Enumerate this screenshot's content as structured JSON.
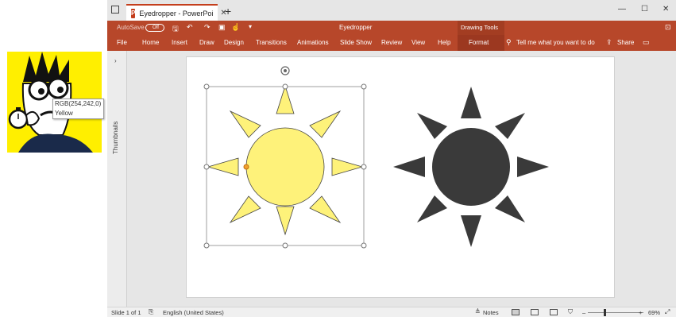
{
  "tooltip": {
    "rgb": "RGB(254,242,0)",
    "name": "Yellow"
  },
  "window": {
    "tab_title": "Eyedropper - PowerPoi",
    "doc_title": "Eyedropper",
    "autosave_label": "AutoSave",
    "autosave_state": "Off",
    "context_group": "Drawing Tools"
  },
  "ribbon": {
    "tabs": [
      "File",
      "Home",
      "Insert",
      "Draw",
      "Design",
      "Transitions",
      "Animations",
      "Slide Show",
      "Review",
      "View",
      "Help",
      "Format"
    ],
    "tell_me": "Tell me what you want to do",
    "share": "Share"
  },
  "panes": {
    "thumbnails": "Thumbnails"
  },
  "status": {
    "slide": "Slide 1 of 1",
    "language": "English (United States)",
    "notes": "Notes",
    "zoom": "69%"
  },
  "colors": {
    "accent": "#b7472a",
    "sun_yellow": "#fef27a",
    "sun_dark": "#3a3a3a",
    "cartoon_bg": "#ffef00"
  }
}
